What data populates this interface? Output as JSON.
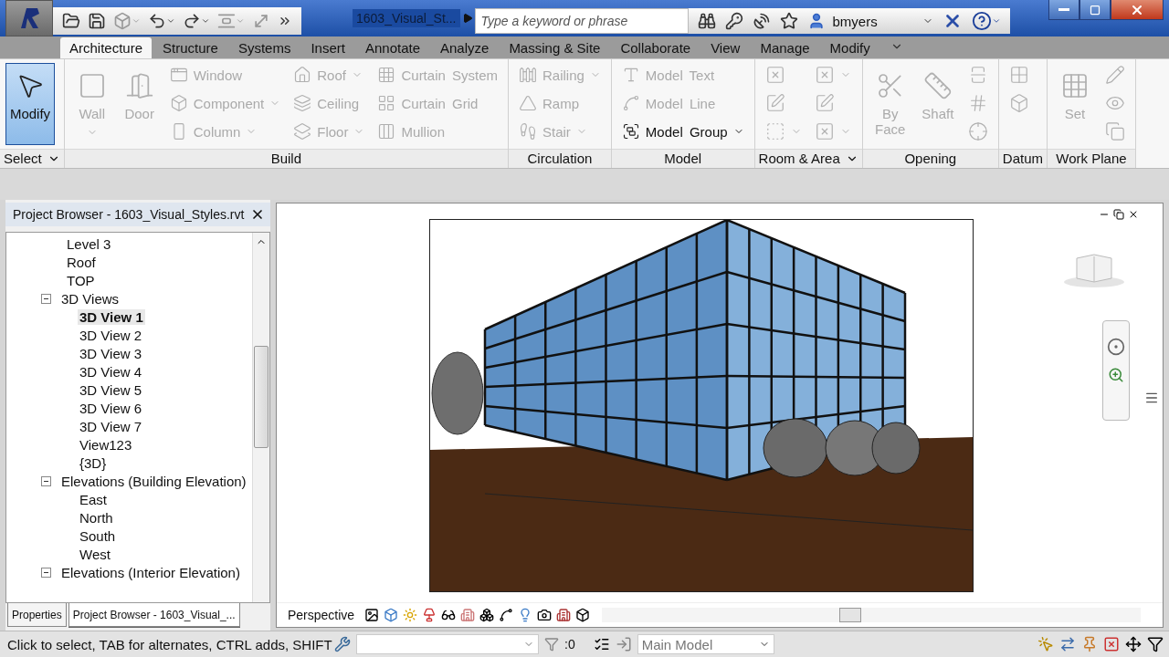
{
  "title_bar": {
    "document_title": "1603_Visual_St...",
    "search": {
      "placeholder": "Type a keyword or phrase"
    },
    "user": "bmyers"
  },
  "ribbon_tabs": [
    {
      "label": "Architecture",
      "selected": true
    },
    {
      "label": "Structure",
      "selected": false
    },
    {
      "label": "Systems",
      "selected": false
    },
    {
      "label": "Insert",
      "selected": false
    },
    {
      "label": "Annotate",
      "selected": false
    },
    {
      "label": "Analyze",
      "selected": false
    },
    {
      "label": "Massing & Site",
      "selected": false
    },
    {
      "label": "Collaborate",
      "selected": false
    },
    {
      "label": "View",
      "selected": false
    },
    {
      "label": "Manage",
      "selected": false
    },
    {
      "label": "Modify",
      "selected": false
    }
  ],
  "ribbon_panels": [
    {
      "label": "Select",
      "menu": true,
      "columns": [
        [
          {
            "kind": "large",
            "label": "Modify",
            "enabled": true,
            "active": true,
            "dropdown": false
          }
        ]
      ]
    },
    {
      "label": "Build",
      "menu": false,
      "columns": [
        [
          {
            "kind": "large",
            "label": "Wall",
            "enabled": false,
            "active": false,
            "dropdown": true
          }
        ],
        [
          {
            "kind": "large",
            "label": "Door",
            "enabled": false,
            "active": false,
            "dropdown": false
          }
        ],
        [
          {
            "kind": "small",
            "label": "Window",
            "enabled": false,
            "active": false,
            "dropdown": false
          },
          {
            "kind": "small",
            "label": "Component",
            "enabled": false,
            "active": false,
            "dropdown": true
          },
          {
            "kind": "small",
            "label": "Column",
            "enabled": false,
            "active": false,
            "dropdown": true
          }
        ],
        [
          {
            "kind": "small",
            "label": "Roof",
            "enabled": false,
            "active": false,
            "dropdown": true
          },
          {
            "kind": "small",
            "label": "Ceiling",
            "enabled": false,
            "active": false,
            "dropdown": false
          },
          {
            "kind": "small",
            "label": "Floor",
            "enabled": false,
            "active": false,
            "dropdown": true
          }
        ],
        [
          {
            "kind": "small",
            "label": "Curtain System",
            "enabled": false,
            "active": false,
            "dropdown": false
          },
          {
            "kind": "small",
            "label": "Curtain Grid",
            "enabled": false,
            "active": false,
            "dropdown": false
          },
          {
            "kind": "small",
            "label": "Mullion",
            "enabled": false,
            "active": false,
            "dropdown": false
          }
        ]
      ]
    },
    {
      "label": "Circulation",
      "menu": false,
      "columns": [
        [
          {
            "kind": "small",
            "label": "Railing",
            "enabled": false,
            "active": false,
            "dropdown": true
          },
          {
            "kind": "small",
            "label": "Ramp",
            "enabled": false,
            "active": false,
            "dropdown": false
          },
          {
            "kind": "small",
            "label": "Stair",
            "enabled": false,
            "active": false,
            "dropdown": true
          }
        ]
      ]
    },
    {
      "label": "Model",
      "menu": false,
      "columns": [
        [
          {
            "kind": "small",
            "label": "Model Text",
            "enabled": false,
            "active": false,
            "dropdown": false
          },
          {
            "kind": "small",
            "label": "Model Line",
            "enabled": false,
            "active": false,
            "dropdown": false
          },
          {
            "kind": "small",
            "label": "Model Group",
            "enabled": true,
            "active": false,
            "dropdown": true
          }
        ]
      ]
    },
    {
      "label": "Room & Area",
      "menu": true,
      "columns": [
        [
          {
            "kind": "icon",
            "enabled": false,
            "active": false,
            "dropdown": false
          },
          {
            "kind": "icon",
            "enabled": false,
            "active": false,
            "dropdown": false
          },
          {
            "kind": "icon",
            "enabled": false,
            "active": false,
            "dropdown": true
          }
        ],
        [
          {
            "kind": "icon",
            "enabled": false,
            "active": false,
            "dropdown": true
          },
          {
            "kind": "icon",
            "enabled": false,
            "active": false,
            "dropdown": false
          },
          {
            "kind": "icon",
            "enabled": false,
            "active": false,
            "dropdown": true
          }
        ]
      ]
    },
    {
      "label": "Opening",
      "menu": false,
      "columns": [
        [
          {
            "kind": "large",
            "label": "By Face",
            "enabled": false,
            "active": false,
            "dropdown": false
          }
        ],
        [
          {
            "kind": "large",
            "label": "Shaft",
            "enabled": false,
            "active": false,
            "dropdown": false
          }
        ],
        [
          {
            "kind": "icon",
            "enabled": false,
            "active": false,
            "dropdown": false
          },
          {
            "kind": "icon",
            "enabled": false,
            "active": false,
            "dropdown": false
          },
          {
            "kind": "icon",
            "enabled": false,
            "active": false,
            "dropdown": false
          }
        ]
      ]
    },
    {
      "label": "Datum",
      "menu": false,
      "columns": [
        [
          {
            "kind": "icon",
            "enabled": false,
            "active": false,
            "dropdown": false
          },
          {
            "kind": "icon",
            "enabled": false,
            "active": false,
            "dropdown": false
          }
        ]
      ]
    },
    {
      "label": "Work Plane",
      "menu": false,
      "columns": [
        [
          {
            "kind": "large",
            "label": "Set",
            "enabled": false,
            "active": false,
            "dropdown": false
          }
        ],
        [
          {
            "kind": "icon",
            "enabled": false,
            "active": false,
            "dropdown": false
          },
          {
            "kind": "icon",
            "enabled": false,
            "active": false,
            "dropdown": false
          },
          {
            "kind": "icon",
            "enabled": false,
            "active": false,
            "dropdown": false
          }
        ]
      ]
    }
  ],
  "project_browser": {
    "title": "Project Browser - 1603_Visual_Styles.rvt",
    "continued_items": [
      {
        "label": "Level 3",
        "selected": false
      },
      {
        "label": "Roof",
        "selected": false
      },
      {
        "label": "TOP",
        "selected": false
      }
    ],
    "nodes": [
      {
        "label": "3D Views",
        "expanded": true,
        "children": [
          {
            "label": "3D View 1",
            "selected": true
          },
          {
            "label": "3D View 2",
            "selected": false
          },
          {
            "label": "3D View 3",
            "selected": false
          },
          {
            "label": "3D View 4",
            "selected": false
          },
          {
            "label": "3D View 5",
            "selected": false
          },
          {
            "label": "3D View 6",
            "selected": false
          },
          {
            "label": "3D View 7",
            "selected": false
          },
          {
            "label": "View123",
            "selected": false
          },
          {
            "label": "{3D}",
            "selected": false
          }
        ]
      },
      {
        "label": "Elevations (Building Elevation)",
        "expanded": true,
        "children": [
          {
            "label": "East",
            "selected": false
          },
          {
            "label": "North",
            "selected": false
          },
          {
            "label": "South",
            "selected": false
          },
          {
            "label": "West",
            "selected": false
          }
        ]
      },
      {
        "label": "Elevations (Interior Elevation)",
        "expanded": true
      }
    ]
  },
  "palette_tabs": [
    {
      "label": "Properties",
      "selected": false
    },
    {
      "label": "Project Browser - 1603_Visual_...",
      "selected": true
    }
  ],
  "view_control_bar": {
    "label": "Perspective"
  },
  "status_bar": {
    "message": "Click to select, TAB for alternates, CTRL adds, SHIFT",
    "selection_count": ":0",
    "active_model": "Main Model"
  }
}
